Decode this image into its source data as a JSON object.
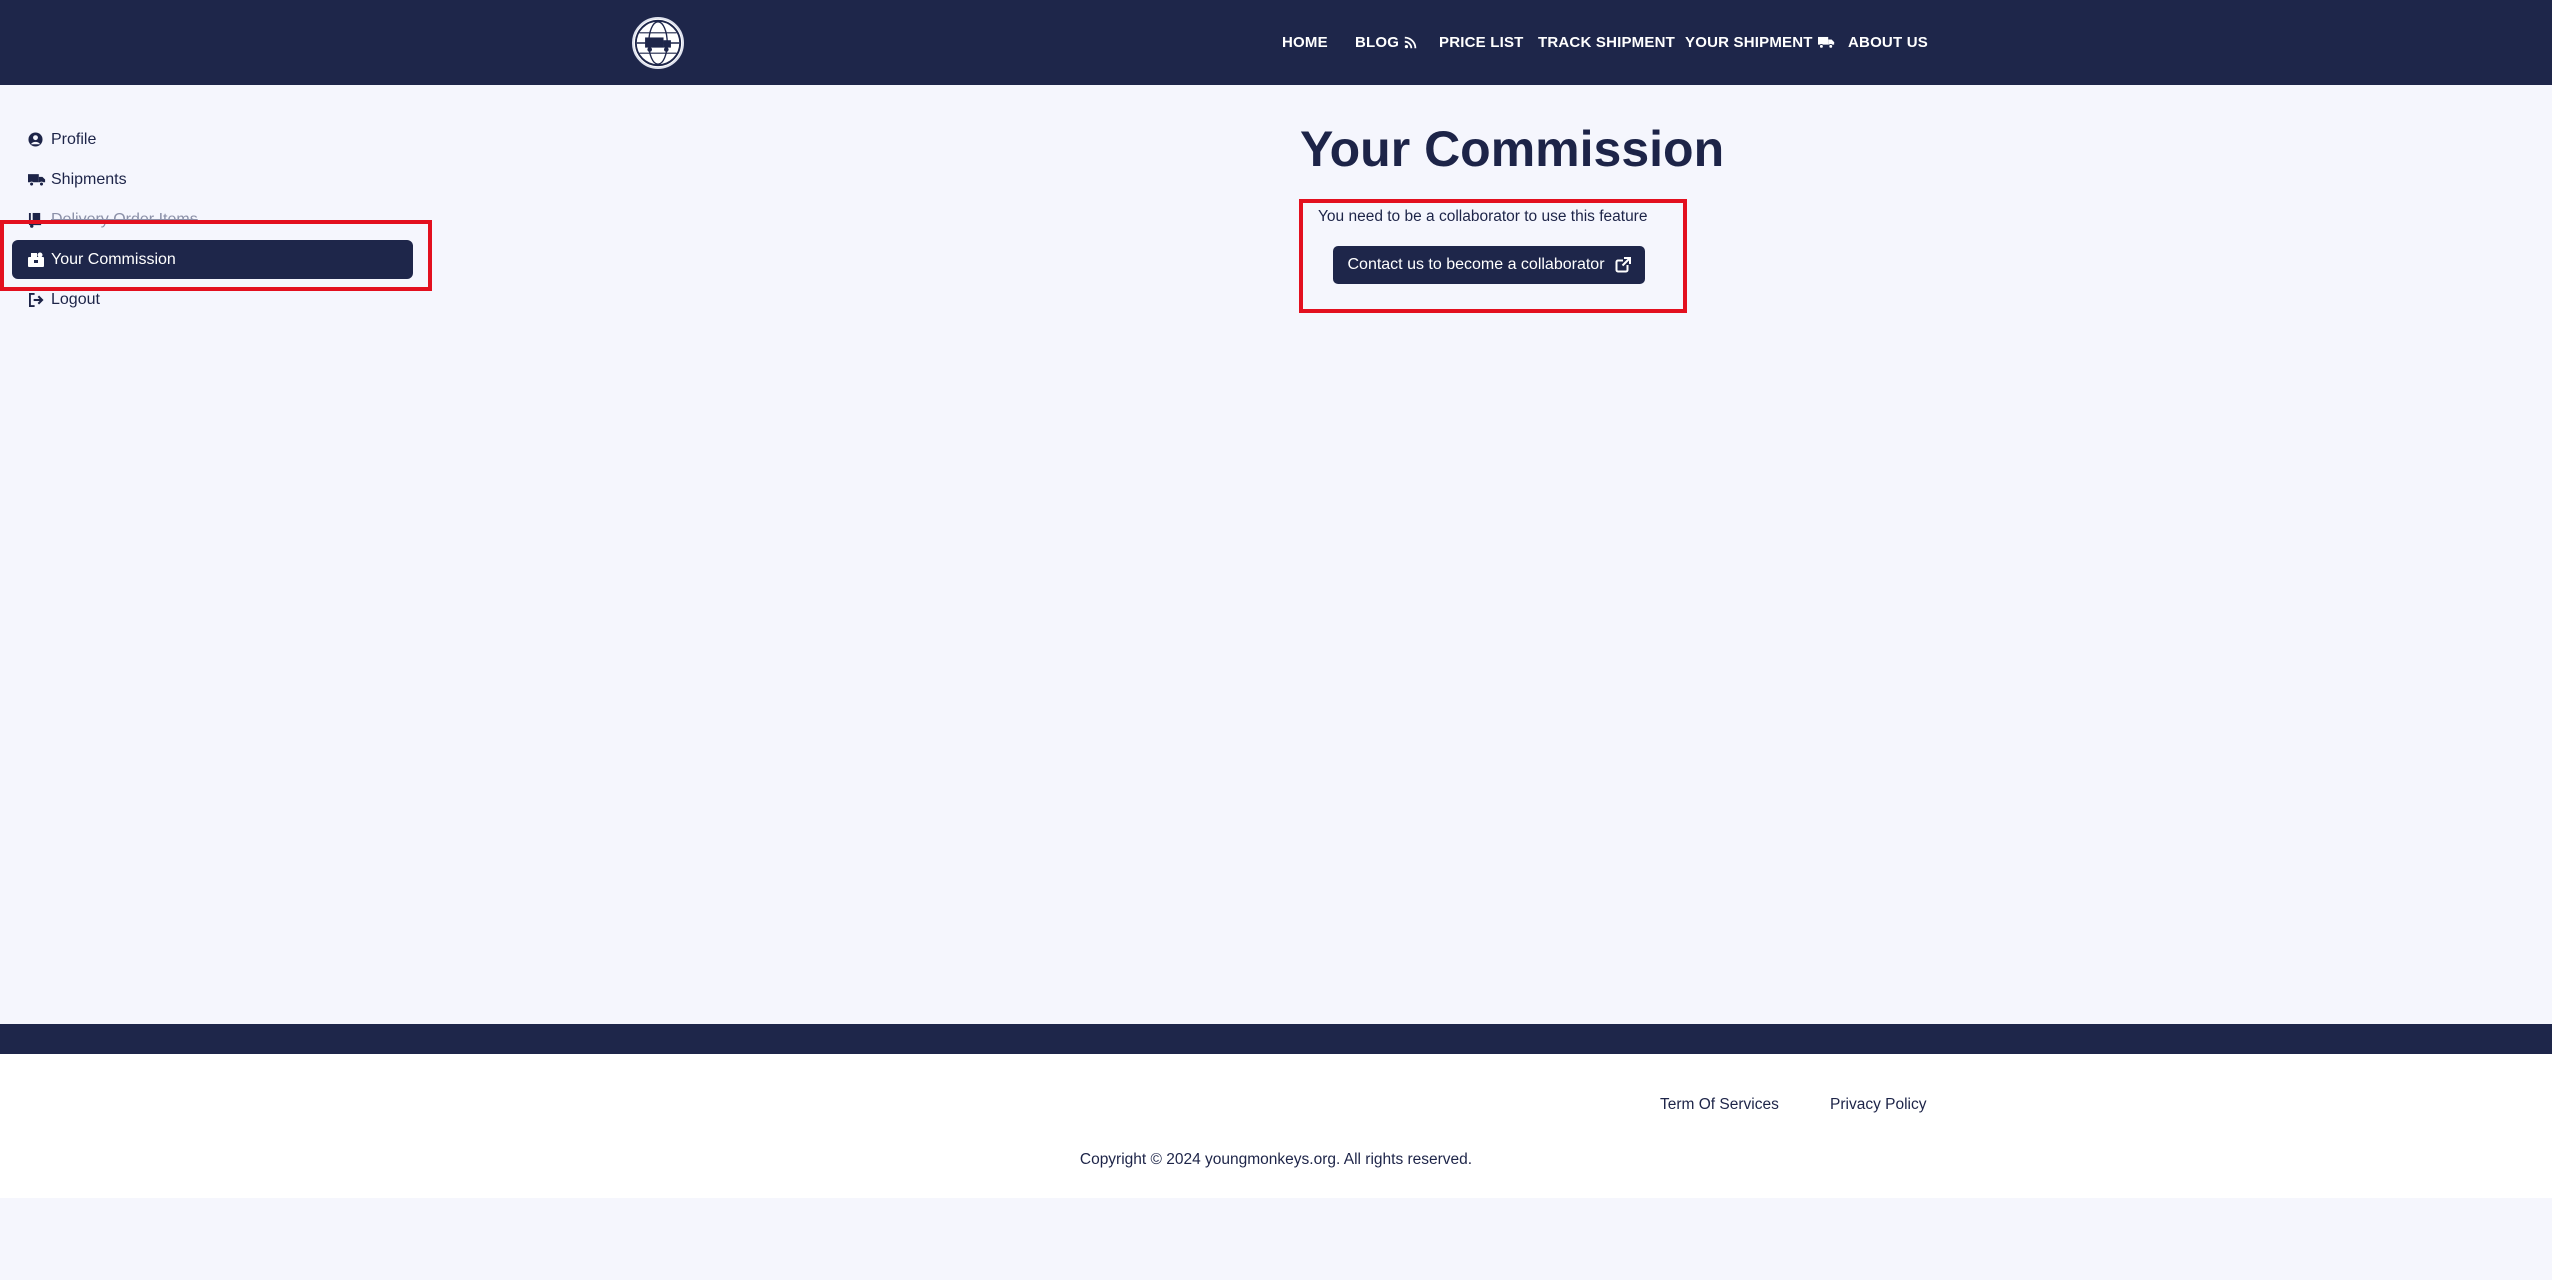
{
  "header": {
    "logo_name": "globe-truck-logo",
    "nav": [
      {
        "label": "HOME",
        "icon": ""
      },
      {
        "label": "BLOG",
        "icon": "rss-icon"
      },
      {
        "label": "PRICE LIST",
        "icon": ""
      },
      {
        "label": "TRACK SHIPMENT",
        "icon": ""
      },
      {
        "label": "YOUR SHIPMENT",
        "icon": "truck-icon"
      },
      {
        "label": "ABOUT US",
        "icon": ""
      }
    ]
  },
  "sidebar": {
    "items": [
      {
        "label": "Profile",
        "icon": "user-circle-icon"
      },
      {
        "label": "Shipments",
        "icon": "truck-icon"
      },
      {
        "label": "Delivery Order Items",
        "icon": "dolly-icon"
      },
      {
        "label": "Your Commission",
        "icon": "money-box-icon",
        "active": true
      },
      {
        "label": "Logout",
        "icon": "logout-icon"
      }
    ]
  },
  "main": {
    "title": "Your Commission",
    "notice": "You need to be a collaborator to use this feature",
    "contact_button": "Contact us to become a collaborator"
  },
  "footer": {
    "links": [
      "Term Of Services",
      "Privacy Policy"
    ],
    "copyright": "Copyright © 2024 youngmonkeys.org. All rights reserved."
  },
  "colors": {
    "navy": "#1e264a",
    "background": "#f5f6fd",
    "highlight": "#e3101f"
  }
}
